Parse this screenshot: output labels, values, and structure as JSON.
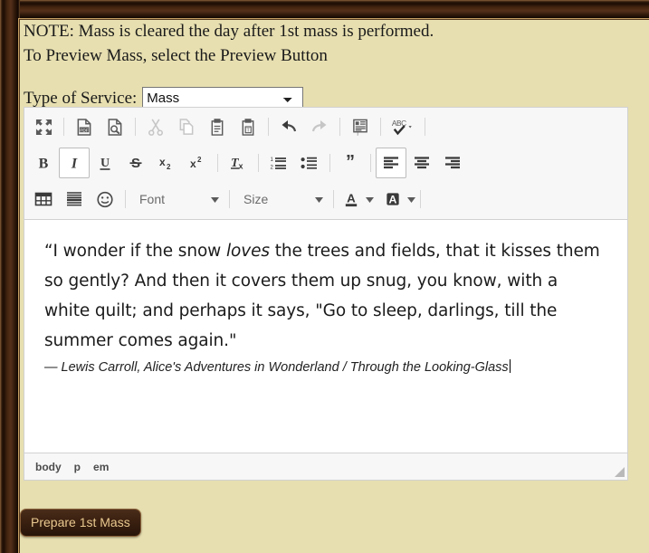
{
  "window": {
    "frame_color": "#2b1608",
    "frame_highlight": "#c9a064",
    "page_background": "#e7dfb0"
  },
  "notes": {
    "line1": "NOTE: Mass is cleared the day after 1st mass is performed.",
    "line2": "To Preview Mass, select the Preview Button"
  },
  "service": {
    "label": "Type of Service:",
    "selected": "Mass",
    "options": [
      "Mass"
    ]
  },
  "editor": {
    "toolbar": {
      "row1": [
        {
          "name": "maximize",
          "title": "Maximize",
          "enabled": true
        },
        {
          "name": "pdf",
          "title": "PDF",
          "enabled": true
        },
        {
          "name": "preview",
          "title": "Preview",
          "enabled": true
        },
        {
          "name": "cut",
          "title": "Cut",
          "enabled": false
        },
        {
          "name": "copy",
          "title": "Copy",
          "enabled": false
        },
        {
          "name": "paste",
          "title": "Paste",
          "enabled": true
        },
        {
          "name": "paste-text",
          "title": "Paste as plain text",
          "enabled": true
        },
        {
          "name": "undo",
          "title": "Undo",
          "enabled": true
        },
        {
          "name": "redo",
          "title": "Redo",
          "enabled": false
        },
        {
          "name": "templates",
          "title": "Templates",
          "enabled": true
        },
        {
          "name": "spellcheck",
          "title": "Spell Check As You Type",
          "enabled": true,
          "has_arrow": true
        }
      ],
      "row2": [
        {
          "name": "bold",
          "title": "Bold",
          "label": "B",
          "active": false
        },
        {
          "name": "italic",
          "title": "Italic",
          "label": "I",
          "active": true
        },
        {
          "name": "underline",
          "title": "Underline",
          "label": "U",
          "active": false
        },
        {
          "name": "strike",
          "title": "Strikethrough",
          "label": "S",
          "active": false
        },
        {
          "name": "subscript",
          "title": "Subscript",
          "label": "x₂",
          "active": false
        },
        {
          "name": "superscript",
          "title": "Superscript",
          "label": "x²",
          "active": false
        },
        {
          "name": "remove-format",
          "title": "Remove Format",
          "label": "Tx",
          "active": false
        },
        {
          "name": "numbered-list",
          "title": "Insert/Remove Numbered List",
          "active": false
        },
        {
          "name": "bulleted-list",
          "title": "Insert/Remove Bulleted List",
          "active": false
        },
        {
          "name": "blockquote",
          "title": "Block Quote",
          "active": false
        },
        {
          "name": "align-left",
          "title": "Align Left",
          "active": true
        },
        {
          "name": "align-center",
          "title": "Center",
          "active": false
        },
        {
          "name": "align-right",
          "title": "Align Right",
          "active": false
        }
      ],
      "row3": {
        "table": "Table",
        "horizontal_rule": "Insert Horizontal Line",
        "smiley": "Insert Smiley",
        "font_label": "Font",
        "size_label": "Size",
        "text_color": "Text Color",
        "background_color": "Background Color"
      }
    },
    "content": {
      "quote_part1": "“I wonder if the snow ",
      "quote_italic": "loves",
      "quote_part2": " the trees and fields, that it kisses them so gently? And then it covers them up snug, you know, with a white quilt; and perhaps it says, \"Go to sleep, darlings, till the summer comes again.\"",
      "attribution": "— Lewis Carroll, Alice's Adventures in Wonderland / Through the Looking-Glass"
    },
    "elements_path": [
      "body",
      "p",
      "em"
    ]
  },
  "actions": {
    "prepare_button": "Prepare 1st Mass"
  }
}
